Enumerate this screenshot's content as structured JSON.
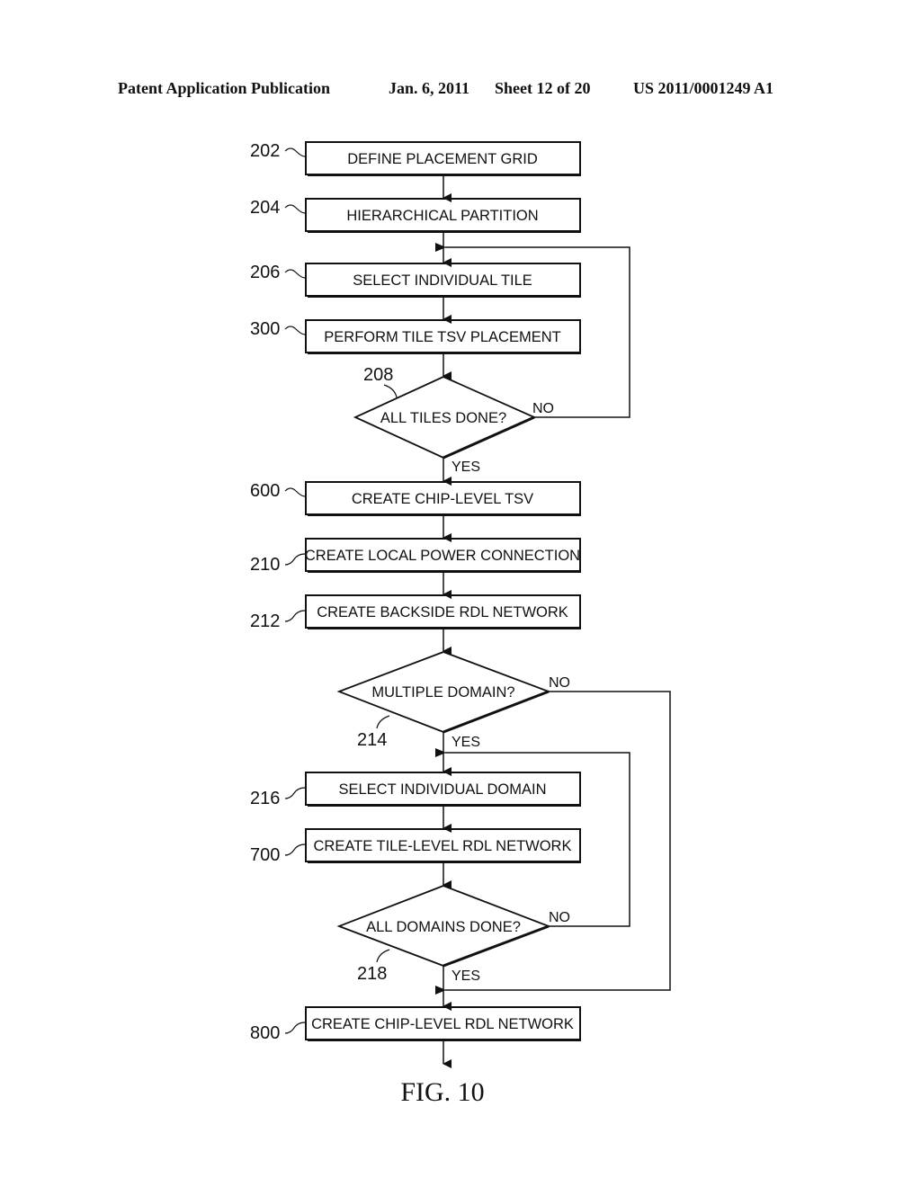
{
  "header": {
    "publication": "Patent Application Publication",
    "date": "Jan. 6, 2011",
    "sheet": "Sheet 12 of 20",
    "number": "US 2011/0001249 A1"
  },
  "figure_label": "FIG. 10",
  "steps": [
    {
      "ref": "202",
      "text": "DEFINE PLACEMENT GRID"
    },
    {
      "ref": "204",
      "text": "HIERARCHICAL PARTITION"
    },
    {
      "ref": "206",
      "text": "SELECT INDIVIDUAL TILE"
    },
    {
      "ref": "300",
      "text": "PERFORM TILE TSV PLACEMENT"
    },
    {
      "ref": "600",
      "text": "CREATE CHIP-LEVEL TSV"
    },
    {
      "ref": "210",
      "text": "CREATE LOCAL POWER CONNECTION"
    },
    {
      "ref": "212",
      "text": "CREATE BACKSIDE RDL NETWORK"
    },
    {
      "ref": "216",
      "text": "SELECT INDIVIDUAL DOMAIN"
    },
    {
      "ref": "700",
      "text": "CREATE TILE-LEVEL RDL NETWORK"
    },
    {
      "ref": "800",
      "text": "CREATE CHIP-LEVEL RDL NETWORK"
    }
  ],
  "decisions": [
    {
      "ref": "208",
      "text": "ALL TILES DONE?",
      "yes": "YES",
      "no": "NO"
    },
    {
      "ref": "214",
      "text": "MULTIPLE DOMAIN?",
      "yes": "YES",
      "no": "NO"
    },
    {
      "ref": "218",
      "text": "ALL DOMAINS DONE?",
      "yes": "YES",
      "no": "NO"
    }
  ]
}
